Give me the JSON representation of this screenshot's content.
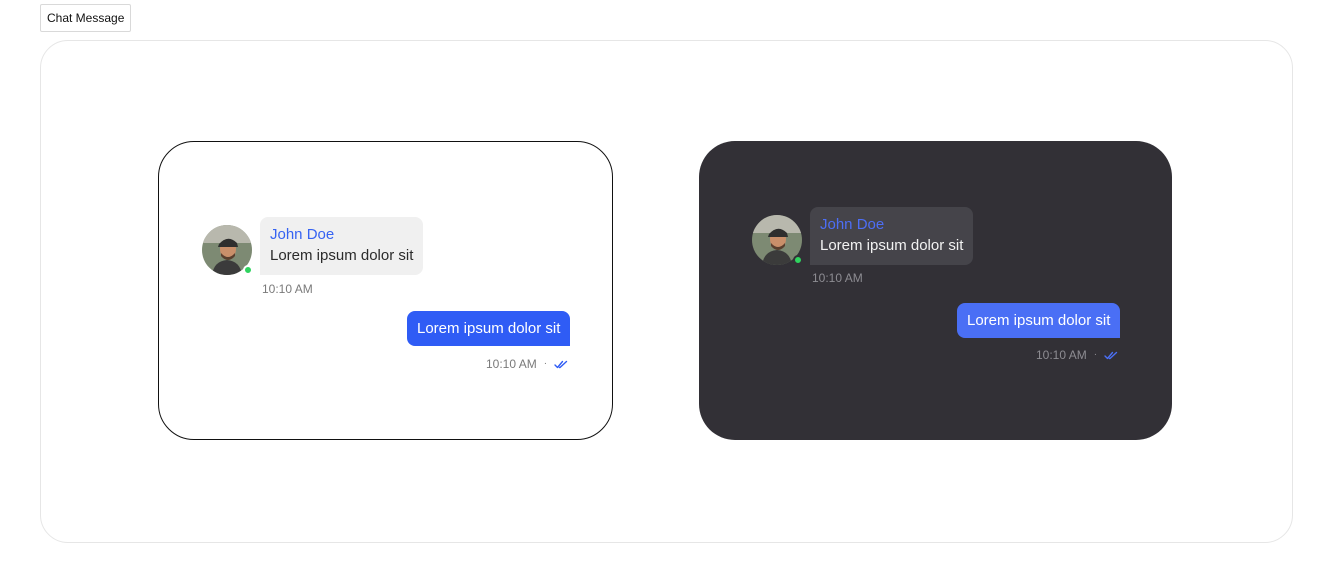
{
  "tab": {
    "label": "Chat Message"
  },
  "light": {
    "incoming": {
      "sender": "John Doe",
      "text": "Lorem ipsum dolor sit",
      "time": "10:10 AM"
    },
    "outgoing": {
      "text": "Lorem ipsum dolor sit",
      "time": "10:10 AM",
      "separator": "·"
    }
  },
  "dark": {
    "incoming": {
      "sender": "John Doe",
      "text": "Lorem ipsum dolor sit",
      "time": "10:10 AM"
    },
    "outgoing": {
      "text": "Lorem ipsum dolor sit",
      "time": "10:10 AM",
      "separator": "·"
    }
  },
  "colors": {
    "accent": "#2f5cf5",
    "sender": "#3663f2",
    "online": "#2fd35f",
    "dark_bg": "#323036"
  },
  "icons": {
    "status": "online-status-icon",
    "read": "double-check-icon",
    "avatar": "user-avatar"
  }
}
